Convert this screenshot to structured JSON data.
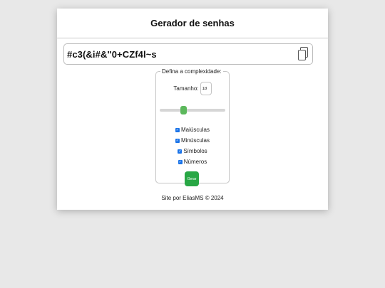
{
  "header": {
    "title": "Gerador de senhas"
  },
  "password": {
    "value": "#c3(&i#&\"0+CZf4l~s",
    "copy_icon": "copy-icon"
  },
  "complexity": {
    "legend": "Defina a complexidade:",
    "size_label": "Tamanho:",
    "size_value": "18",
    "slider_fraction": 0.36,
    "options": [
      {
        "label": "Maiúsculas",
        "checked": true
      },
      {
        "label": "Minúsculas",
        "checked": true
      },
      {
        "label": "Símbolos",
        "checked": true
      },
      {
        "label": "Números",
        "checked": true
      }
    ],
    "generate_label": "Gerar"
  },
  "footer": {
    "text": "Site por EliasMS © 2024"
  },
  "colors": {
    "accent": "#28a745",
    "slider_thumb": "#5cb85c",
    "checkbox": "#1a73e8"
  }
}
